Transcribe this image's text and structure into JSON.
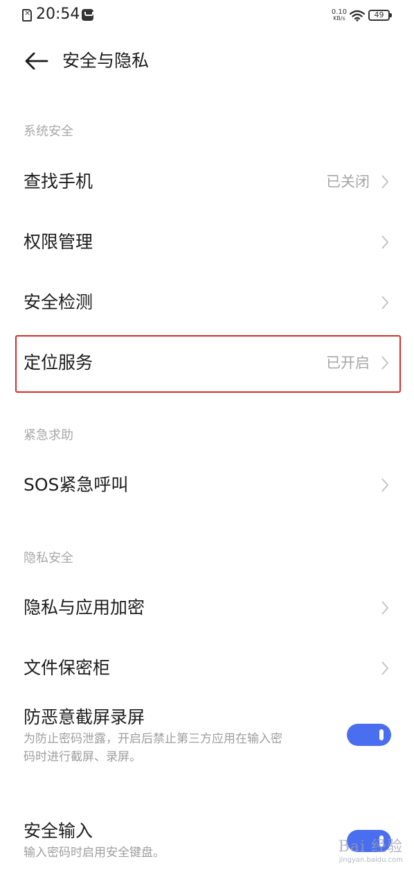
{
  "status_bar": {
    "time": "20:54",
    "net_speed_value": "0.10",
    "net_speed_unit": "KB/s",
    "battery": "49",
    "icons": [
      "sim-icon",
      "notification-icon",
      "wifi-icon",
      "battery-icon"
    ]
  },
  "header": {
    "title": "安全与隐私"
  },
  "sections": {
    "system_security": {
      "title": "系统安全",
      "items": [
        {
          "label": "查找手机",
          "value": "已关闭"
        },
        {
          "label": "权限管理"
        },
        {
          "label": "安全检测"
        },
        {
          "label": "定位服务",
          "value": "已开启"
        }
      ]
    },
    "emergency": {
      "title": "紧急求助",
      "items": [
        {
          "label": "SOS紧急呼叫"
        }
      ]
    },
    "privacy": {
      "title": "隐私安全",
      "items": [
        {
          "label": "隐私与应用加密"
        },
        {
          "label": "文件保密柜"
        },
        {
          "label": "防恶意截屏录屏",
          "description_line1": "为防止密码泄露，开启后禁止第三方应用在输入密",
          "description_line2": "码时进行截屏、录屏。",
          "toggle_on": true
        },
        {
          "label": "安全输入",
          "description": "输入密码时启用安全键盘。",
          "toggle_on": true
        }
      ]
    }
  },
  "watermark": {
    "logo": "Bai 经验",
    "url": "jingyan.baidu.com"
  },
  "colors": {
    "accent": "#4a6ef0",
    "highlight": "#d62b2b",
    "secondary_text": "#a6a6a6"
  }
}
